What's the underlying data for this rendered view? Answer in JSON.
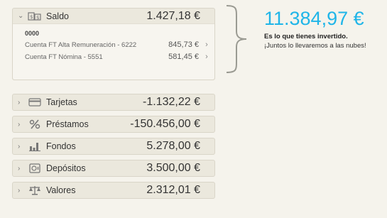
{
  "saldo": {
    "label": "Saldo",
    "amount": "1.427,18 €",
    "account_id": "0000",
    "accounts": [
      {
        "name": "Cuenta FT Alta Remuneración - 6222",
        "amount": "845,73 €"
      },
      {
        "name": "Cuenta FT Nómina - 5551",
        "amount": "581,45 €"
      }
    ]
  },
  "categories": [
    {
      "label": "Tarjetas",
      "amount": "-1.132,22 €",
      "icon": "card-icon"
    },
    {
      "label": "Préstamos",
      "amount": "-150.456,00 €",
      "icon": "percent-icon"
    },
    {
      "label": "Fondos",
      "amount": "5.278,00 €",
      "icon": "bar-chart-icon"
    },
    {
      "label": "Depósitos",
      "amount": "3.500,00 €",
      "icon": "safe-icon"
    },
    {
      "label": "Valores",
      "amount": "2.312,01 €",
      "icon": "scale-icon"
    }
  ],
  "summary": {
    "total": "11.384,97 €",
    "line1": "Es lo que tienes invertido.",
    "line2": "¡Juntos lo llevaremos a las nubes!"
  },
  "colors": {
    "accent": "#1fb5e8",
    "panel": "#ebe8dd",
    "background": "#f5f3ec"
  }
}
